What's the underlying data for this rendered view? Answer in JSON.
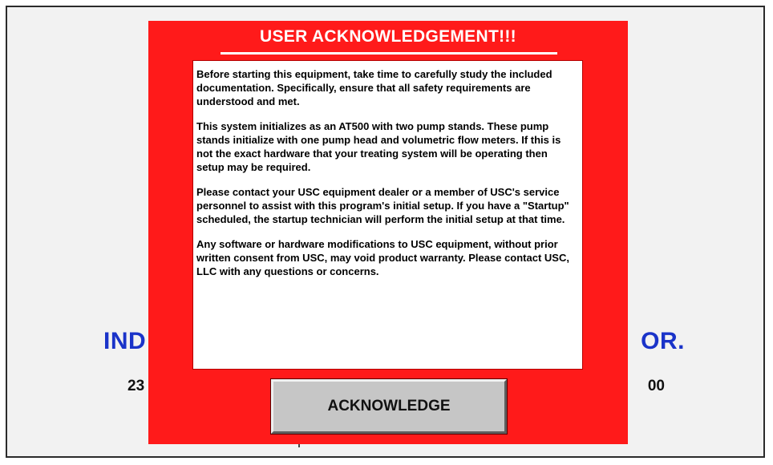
{
  "background": {
    "heading_left": "IND",
    "heading_right": "OR.",
    "subline_left": "23",
    "subline_right": "00"
  },
  "dialog": {
    "title": "USER ACKNOWLEDGEMENT!!!",
    "paragraphs": [
      "Before starting this equipment, take time to carefully study the included documentation.  Specifically, ensure that all safety requirements are understood and met.",
      "This system initializes as an AT500 with two pump stands. These pump stands initialize with one pump head and volumetric flow meters.  If this is not the exact hardware that your treating system will be operating then setup may be required.",
      "Please contact your USC equipment dealer or a member of USC's service personnel to assist with this program's initial setup.  If you have a \"Startup\" scheduled, the startup technician will perform the initial setup at that time.",
      "Any software or hardware modifications to USC equipment, without prior written consent from USC, may void product warranty.  Please contact USC, LLC with any questions or concerns."
    ],
    "button_label": "ACKNOWLEDGE"
  },
  "colors": {
    "dialog_bg": "#ff1a1a",
    "heading_blue": "#1a33c9",
    "button_gray": "#c6c6c6"
  }
}
